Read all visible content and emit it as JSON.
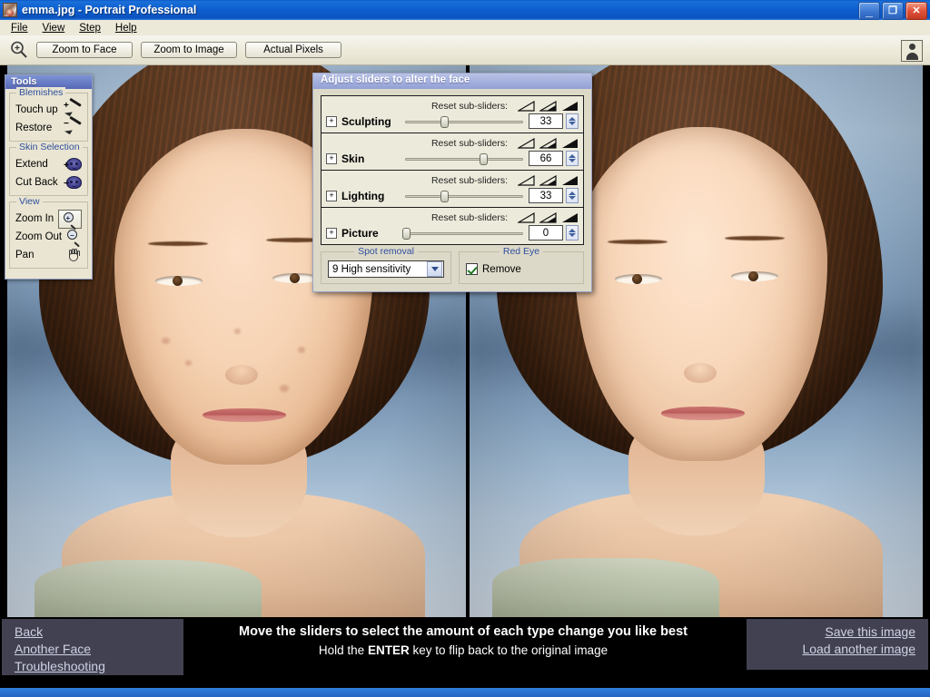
{
  "window": {
    "title": "emma.jpg - Portrait Professional",
    "app_icon": "portrait-app-icon",
    "controls": {
      "minimize": "_",
      "restore": "❐",
      "close": "✕"
    }
  },
  "menu": {
    "items": [
      {
        "label": "File",
        "accel": "F"
      },
      {
        "label": "View",
        "accel": "V"
      },
      {
        "label": "Step",
        "accel": "S"
      },
      {
        "label": "Help",
        "accel": "H"
      }
    ]
  },
  "toolbar": {
    "zoom_icon": "magnifier-icon",
    "buttons": [
      {
        "label": "Zoom to Face"
      },
      {
        "label": "Zoom to Image"
      },
      {
        "label": "Actual Pixels"
      }
    ],
    "person_button": "portrait-person-icon"
  },
  "tools_panel": {
    "title": "Tools",
    "groups": [
      {
        "caption": "Blemishes",
        "items": [
          {
            "label": "Touch up",
            "icon": "brush-plus-icon"
          },
          {
            "label": "Restore",
            "icon": "brush-minus-icon"
          }
        ]
      },
      {
        "caption": "Skin Selection",
        "items": [
          {
            "label": "Extend",
            "icon": "mask-plus-icon"
          },
          {
            "label": "Cut Back",
            "icon": "mask-minus-icon"
          }
        ]
      },
      {
        "caption": "View",
        "items": [
          {
            "label": "Zoom In",
            "icon": "magnifier-plus-icon"
          },
          {
            "label": "Zoom Out",
            "icon": "magnifier-minus-icon"
          },
          {
            "label": "Pan",
            "icon": "hand-icon"
          }
        ]
      }
    ]
  },
  "dialog": {
    "title": "Adjust sliders to alter the face",
    "reset_label": "Reset sub-sliders:",
    "reset_icons": [
      "ramp-low-icon",
      "ramp-medium-icon",
      "ramp-high-icon"
    ],
    "sliders": [
      {
        "name": "Sculpting",
        "value": "33",
        "percent": 33,
        "expander": "+"
      },
      {
        "name": "Skin",
        "value": "66",
        "percent": 66,
        "expander": "+"
      },
      {
        "name": "Lighting",
        "value": "33",
        "percent": 33,
        "expander": "+"
      },
      {
        "name": "Picture",
        "value": "0",
        "percent": 0,
        "expander": "+"
      }
    ],
    "spot_removal": {
      "caption": "Spot removal",
      "selected": "9 High sensitivity"
    },
    "red_eye": {
      "caption": "Red Eye",
      "checkbox_label": "Remove",
      "checked": true
    }
  },
  "workarea": {
    "left_photo": "original-portrait",
    "right_photo": "retouched-portrait"
  },
  "bottom": {
    "left_links": [
      "Back",
      "Another Face",
      "Troubleshooting"
    ],
    "instruction_line1": "Move the sliders to select the amount of each type change you like best",
    "instruction_line2_pre": "Hold the ",
    "instruction_line2_key": "ENTER",
    "instruction_line2_post": " key to flip back to the original image",
    "right_links": [
      "Save this image",
      "Load another image"
    ]
  },
  "colors": {
    "titlebar_blue": "#0b53bf",
    "dialog_header": "#a3afdd",
    "panel_cream": "#e9e5d2",
    "group_caption": "#2f4f9e",
    "bottom_panel": "#414151",
    "statusbar": "#2b72cf"
  }
}
